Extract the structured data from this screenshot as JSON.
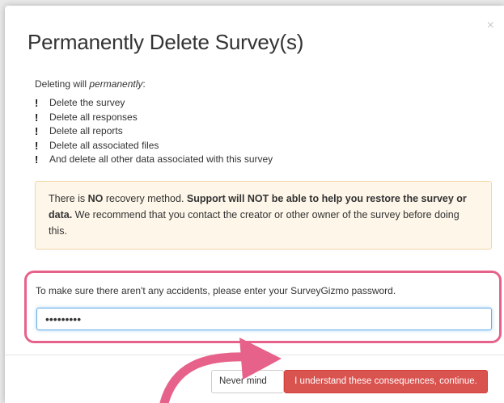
{
  "dialog": {
    "title": "Permanently Delete Survey(s)",
    "close_glyph": "×",
    "intro_prefix": "Deleting will ",
    "intro_emphasis": "permanently",
    "intro_suffix": ":",
    "bullet_glyph": "!",
    "bullets": [
      "Delete the survey",
      "Delete all responses",
      "Delete all reports",
      "Delete all associated files",
      "And delete all other data associated with this survey"
    ],
    "warning": {
      "part1": "There is ",
      "bold1": "NO",
      "part2": " recovery method. ",
      "bold2": "Support will NOT be able to help you restore the survey or data.",
      "part3": " We recommend that you contact the creator or other owner of the survey before doing this."
    },
    "password": {
      "label": "To make sure there aren't any accidents, please enter your SurveyGizmo password.",
      "value": "•••••••••"
    },
    "buttons": {
      "never_label": "Never mind",
      "confirm_label": "I understand these consequences, continue."
    }
  },
  "colors": {
    "highlight_annotation": "#e6628a",
    "confirm_button": "#d9534f",
    "warning_background": "#fdf6e9"
  },
  "icons": {
    "close": "close-icon",
    "bullet": "exclamation-icon",
    "annotation": "curved-arrow-icon"
  }
}
